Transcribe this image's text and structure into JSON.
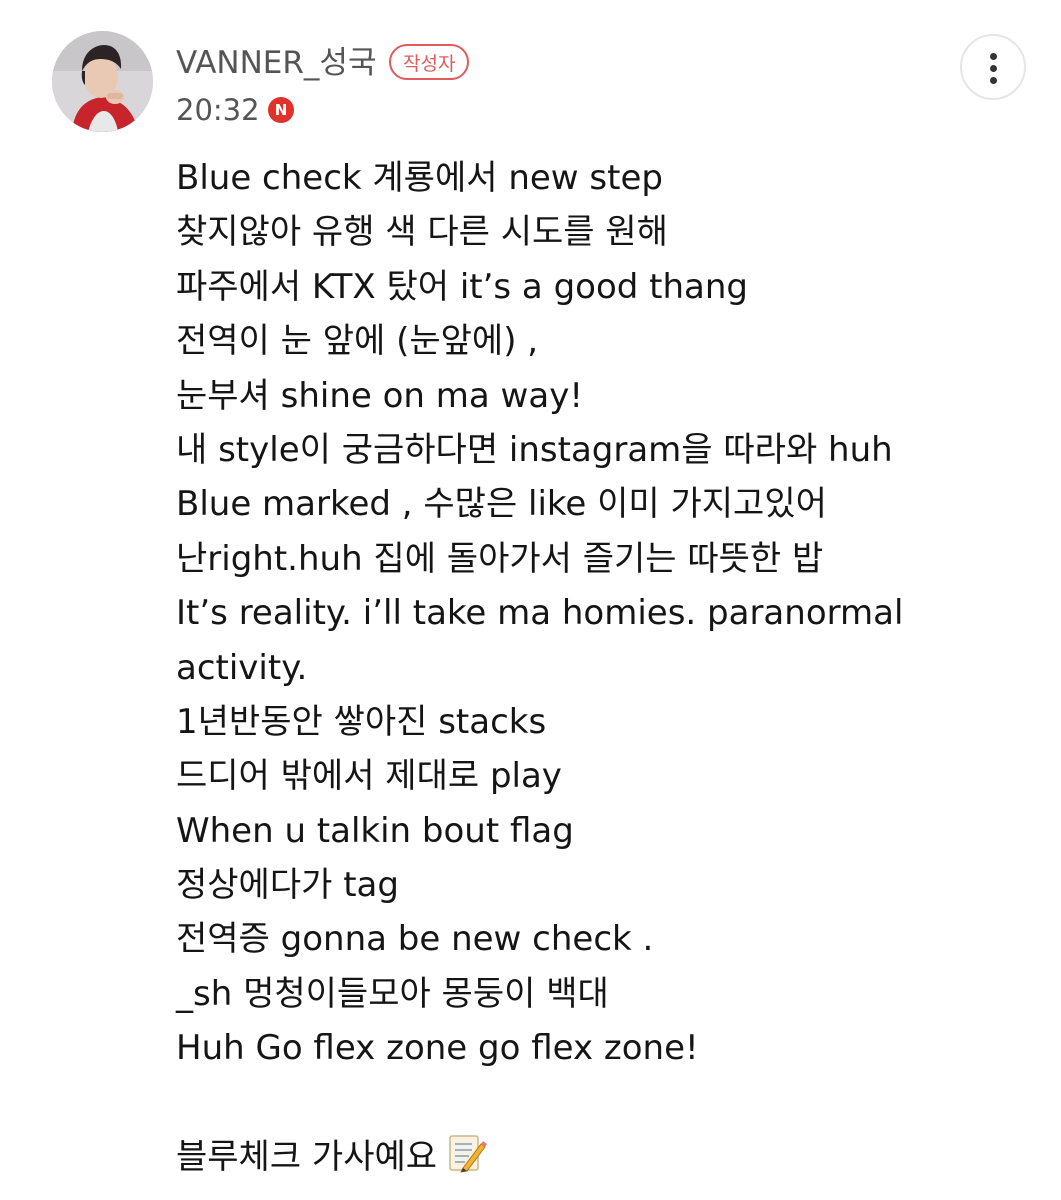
{
  "post": {
    "author": {
      "name": "VANNER_성국",
      "badge": "작성자",
      "avatar": "avatar-photo"
    },
    "time": "20:32",
    "new_badge": "N",
    "more_icon": "more-vertical-icon",
    "colors": {
      "badge_red": "#e35a5a",
      "new_red": "#e0312b",
      "meta_gray": "#555555"
    },
    "lines": [
      "Blue check 계룡에서 new step",
      "찾지않아 유행 색 다른 시도를 원해",
      "파주에서 KTX 탔어 it’s a good thang",
      "전역이 눈 앞에 (눈앞에) ,",
      "눈부셔 shine on ma way!",
      "내 style이 궁금하다면 instagram을 따라와 huh",
      "Blue marked , 수많은 like 이미 가지고있어",
      "난right.huh 집에 돌아가서 즐기는 따뜻한 밥",
      "It’s reality. i’ll take ma homies. paranormal",
      "activity.",
      "1년반동안 쌓아진 stacks",
      "드디어 밖에서 제대로 play",
      "When u talkin bout flag",
      "정상에다가 tag",
      "전역증 gonna be new check .",
      "_sh 멍청이들모아 몽둥이 백대",
      "Huh Go flex zone go flex zone!",
      "",
      "블루체크 가사예요"
    ],
    "closing_icon": "memo-icon"
  }
}
